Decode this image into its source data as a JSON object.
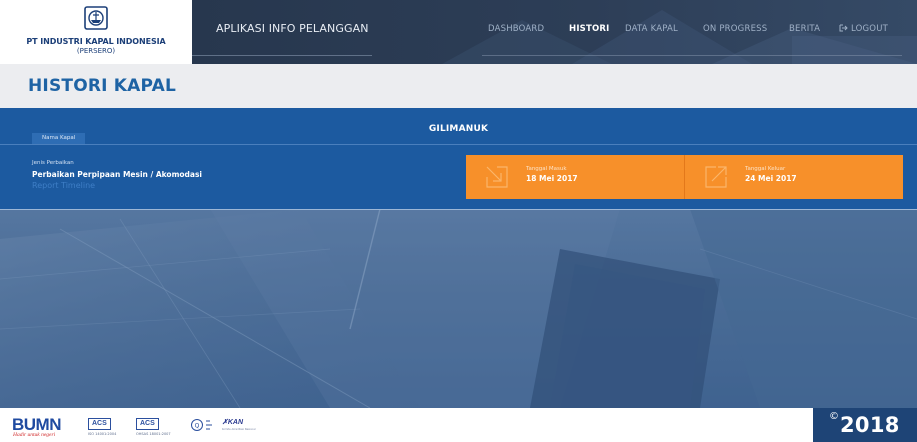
{
  "brand": {
    "company_name": "PT INDUSTRI KAPAL INDONESIA",
    "company_sub": "(PERSERO)",
    "logo_glyph": "IKI",
    "logo_icon": "ship-emblem-icon"
  },
  "header": {
    "app_title": "APLIKASI INFO PELANGGAN",
    "nav": [
      {
        "label": "DASHBOARD",
        "active": false
      },
      {
        "label": "HISTORI",
        "active": true
      },
      {
        "label": "DATA KAPAL",
        "active": false
      },
      {
        "label": "ON PROGRESS",
        "active": false
      },
      {
        "label": "BERITA",
        "active": false
      },
      {
        "label": "LOGOUT",
        "active": false,
        "icon": "logout-icon"
      }
    ]
  },
  "page": {
    "title": "HISTORI KAPAL"
  },
  "ship": {
    "name_badge": "Nama Kapal",
    "name": "GILIMANUK",
    "repair_label": "Jenis Perbaikan",
    "repair_value": "Perbaikan Perpipaan Mesin / Akomodasi",
    "report_link": "Report Timeline",
    "date_in": {
      "label": "Tanggal Masuk",
      "value": "18 Mei 2017",
      "icon": "arrow-in-icon"
    },
    "date_out": {
      "label": "Tanggal Keluar",
      "value": "24 Mei 2017",
      "icon": "arrow-out-icon"
    }
  },
  "footer": {
    "bumn": "BUMN",
    "bumn_tagline": "Hadir untuk negeri",
    "cert1": "ACS",
    "cert1_sub": "ISO 14001:2004",
    "cert2": "ACS",
    "cert2_sub": "OHSAS 18001:2007",
    "kan": "KAN",
    "kan_sub": "Komite Akreditasi Nasional",
    "copyright_symbol": "©",
    "year": "2018"
  },
  "colors": {
    "accent_blue": "#1c5aa0",
    "title_blue": "#1e63a4",
    "orange": "#f7902a",
    "header_dark": "#2d3e57",
    "footer_year": "#1e4476"
  }
}
